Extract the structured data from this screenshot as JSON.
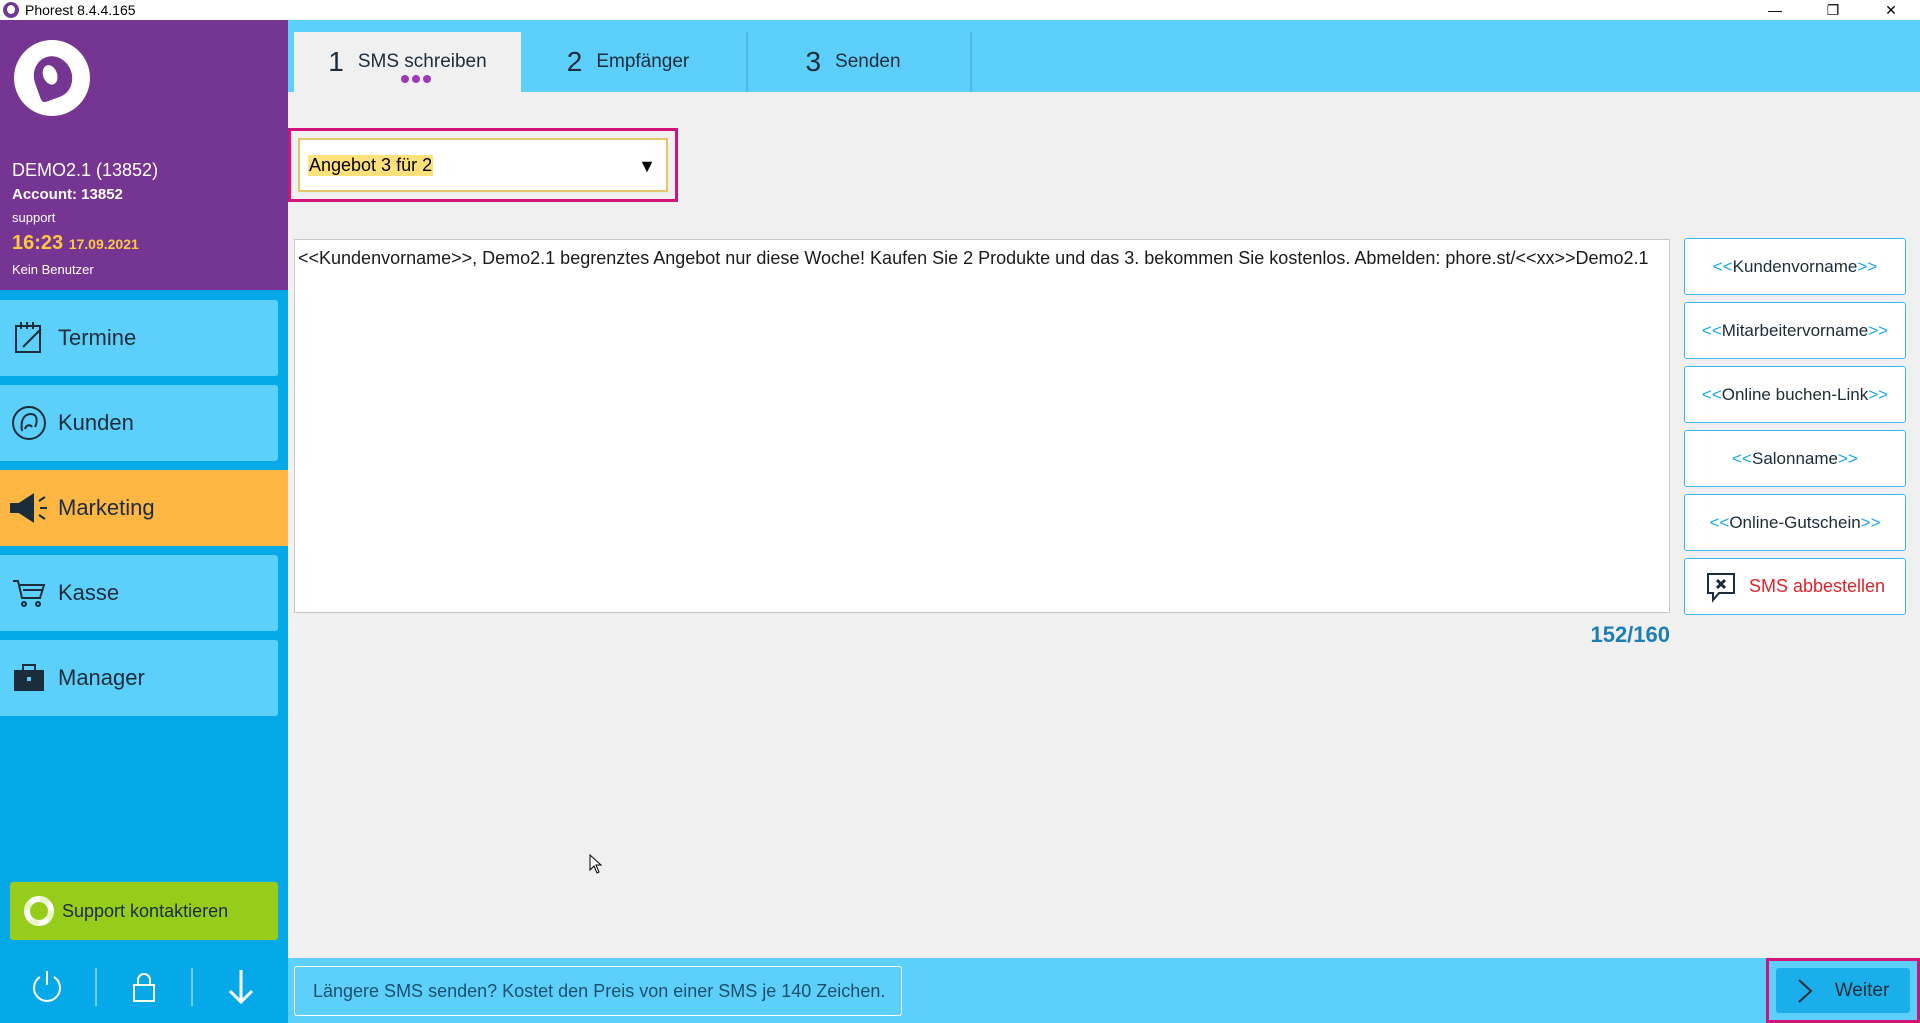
{
  "window": {
    "title": "Phorest 8.4.4.165",
    "minimize": "—",
    "restore": "❐",
    "close": "✕"
  },
  "profile": {
    "account_name": "DEMO2.1 (13852)",
    "account_number": "Account: 13852",
    "user": "support",
    "time": "16:23",
    "date": "17.09.2021",
    "no_user": "Kein Benutzer"
  },
  "nav": [
    {
      "label": "Termine",
      "icon": "calendar-edit-icon"
    },
    {
      "label": "Kunden",
      "icon": "client-head-icon"
    },
    {
      "label": "Marketing",
      "icon": "megaphone-icon",
      "active": true
    },
    {
      "label": "Kasse",
      "icon": "cart-icon"
    },
    {
      "label": "Manager",
      "icon": "briefcase-icon"
    }
  ],
  "support": {
    "label": "Support kontaktieren"
  },
  "tabs": [
    {
      "num": "1",
      "label": "SMS schreiben",
      "active": true
    },
    {
      "num": "2",
      "label": "Empfänger"
    },
    {
      "num": "3",
      "label": "Senden"
    }
  ],
  "template_select": {
    "value": "Angebot 3 für 2"
  },
  "message": {
    "text": "<<Kundenvorname>>, Demo2.1 begrenztes Angebot nur diese Woche! Kaufen Sie 2 Produkte und das 3. bekommen Sie kostenlos. Abmelden: phore.st/<<xx>>Demo2.1",
    "counter": "152/160"
  },
  "placeholders": [
    {
      "open": "<<",
      "label": "Kundenvorname",
      "close": ">>"
    },
    {
      "open": "<<",
      "label": "Mitarbeitervorname",
      "close": ">>"
    },
    {
      "open": "<<",
      "label": "Online buchen-Link",
      "close": ">>"
    },
    {
      "open": "<<",
      "label": "Salonname",
      "close": ">>"
    },
    {
      "open": "<<",
      "label": "Online-Gutschein",
      "close": ">>"
    }
  ],
  "unsubscribe": {
    "label": "SMS abbestellen"
  },
  "footer": {
    "info": "Längere SMS senden? Kostet den Preis von einer SMS je 140 Zeichen.",
    "next_label": "Weiter"
  },
  "colors": {
    "sidebar_purple": "#763592",
    "sidebar_blue": "#05a9e8",
    "nav_item": "#5cd0fb",
    "nav_active": "#ffb642",
    "highlight_border": "#d2147a",
    "support_green": "#96cd1a",
    "unsubscribe_red": "#e2222a"
  }
}
